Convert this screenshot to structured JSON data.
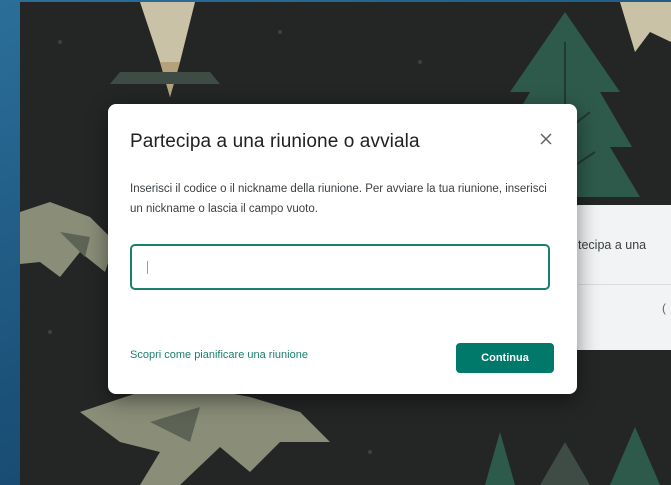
{
  "dialog": {
    "title": "Partecipa a una riunione o avviala",
    "description": "Inserisci il codice o il nickname della riunione. Per avviare la tua riunione, inserisci un nickname o lascia il campo vuoto.",
    "input_value": "",
    "input_placeholder": "",
    "help_link": "Scopri come pianificare una riunione",
    "continue_label": "Continua",
    "close_icon": "close-icon"
  },
  "side_card": {
    "label": "tecipa a una",
    "paren": "("
  },
  "colors": {
    "accent": "#00796b",
    "input_border": "#1a7f6c",
    "background": "#242626"
  }
}
